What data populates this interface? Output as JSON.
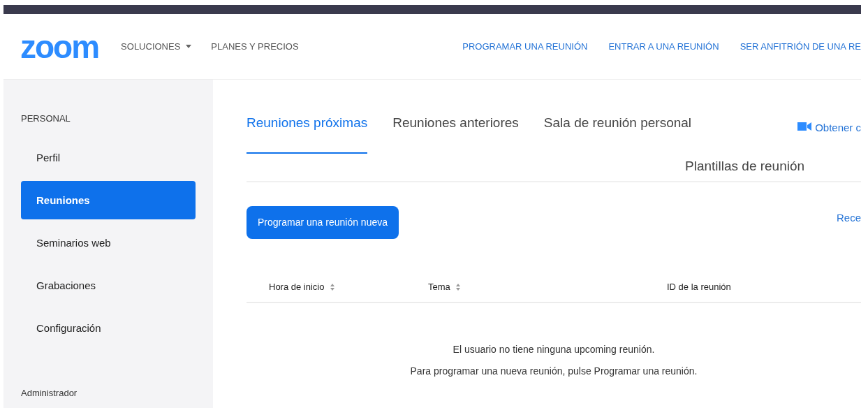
{
  "header": {
    "logo": "zoom",
    "nav_left": [
      {
        "label": "SOLUCIONES",
        "dropdown": true
      },
      {
        "label": "PLANES Y PRECIOS",
        "dropdown": false
      }
    ],
    "nav_right": [
      "PROGRAMAR UNA REUNIÓN",
      "ENTRAR A UNA REUNIÓN",
      "SER ANFITRIÓN DE UNA RE"
    ]
  },
  "sidebar": {
    "section": "PERSONAL",
    "items": [
      {
        "label": "Perfil",
        "selected": false
      },
      {
        "label": "Reuniones",
        "selected": true
      },
      {
        "label": "Seminarios web",
        "selected": false
      },
      {
        "label": "Grabaciones",
        "selected": false
      },
      {
        "label": "Configuración",
        "selected": false
      }
    ],
    "footer_section": "Administrador"
  },
  "tabs": [
    {
      "label": "Reuniones próximas",
      "selected": true
    },
    {
      "label": "Reuniones anteriores",
      "selected": false
    },
    {
      "label": "Sala de reunión personal",
      "selected": false
    },
    {
      "label": "Plantillas de reunión",
      "selected": false
    }
  ],
  "get_link": "Obtener c",
  "schedule_button": "Programar una reunión nueva",
  "recent_link": "Rece",
  "table": {
    "columns": [
      {
        "label": "Hora de inicio",
        "sortable": true
      },
      {
        "label": "Tema",
        "sortable": true
      },
      {
        "label": "ID de la reunión",
        "sortable": false
      }
    ]
  },
  "empty_message": [
    "El usuario no tiene ninguna upcoming reunión.",
    "Para programar una nueva reunión, pulse Programar una reunión."
  ]
}
